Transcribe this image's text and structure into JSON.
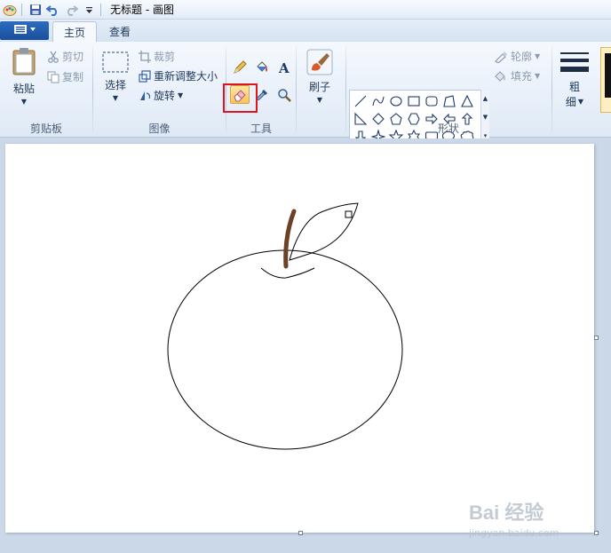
{
  "window": {
    "title": "无标题 - 画图"
  },
  "quick_access": {
    "icons": [
      "paint-app-icon",
      "save-icon",
      "undo-icon",
      "redo-icon",
      "customize-dropdown-icon"
    ]
  },
  "tabs": [
    {
      "label": "主页",
      "active": true
    },
    {
      "label": "查看",
      "active": false
    }
  ],
  "clipboard": {
    "group_label": "剪贴板",
    "paste_label": "粘贴",
    "cut_label": "剪切",
    "copy_label": "复制"
  },
  "image": {
    "group_label": "图像",
    "select_label": "选择",
    "crop_label": "裁剪",
    "resize_label": "重新调整大小",
    "rotate_label": "旋转"
  },
  "tools": {
    "group_label": "工具",
    "items": [
      "pencil",
      "fill",
      "text",
      "eraser",
      "color-picker",
      "magnifier"
    ],
    "selected": "eraser"
  },
  "brushes": {
    "label": "刷子"
  },
  "shapes": {
    "group_label": "形状",
    "outline_label": "轮廓",
    "fill_label": "填充"
  },
  "size": {
    "label_line1": "粗",
    "label_line2": "细"
  },
  "colors": {
    "accent": "#1a4f9c",
    "highlight": "#e0141e",
    "stem": "#6b4226",
    "selected_tool": "#fac35c"
  },
  "watermark": {
    "text": "Bai 经验",
    "url": "jingyan.baidu.com"
  }
}
